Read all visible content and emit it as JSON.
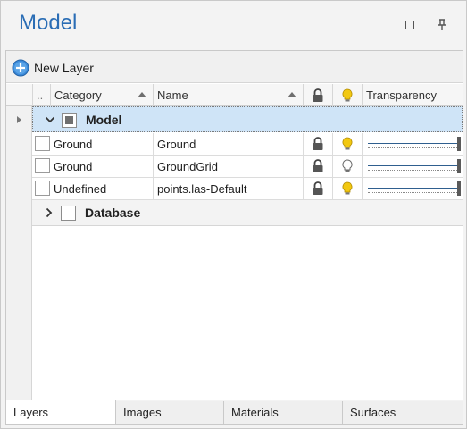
{
  "window": {
    "title": "Model"
  },
  "toolbar": {
    "new_layer_label": "New Layer"
  },
  "columns": {
    "collapse": "..",
    "category": "Category",
    "name": "Name",
    "transparency": "Transparency"
  },
  "groups": [
    {
      "label": "Model",
      "expanded": true,
      "selected": true,
      "checkbox": "indeterminate"
    },
    {
      "label": "Database",
      "expanded": false,
      "selected": false,
      "checkbox": "unchecked"
    }
  ],
  "rows": [
    {
      "category": "Ground",
      "name": "Ground",
      "locked": true,
      "light": "on",
      "transparency": 1.0
    },
    {
      "category": "Ground",
      "name": "GroundGrid",
      "locked": true,
      "light": "off",
      "transparency": 1.0
    },
    {
      "category": "Undefined",
      "name": "points.las-Default",
      "locked": true,
      "light": "on",
      "transparency": 1.0
    }
  ],
  "tabs": [
    {
      "label": "Layers",
      "active": true
    },
    {
      "label": "Images",
      "active": false
    },
    {
      "label": "Materials",
      "active": false
    },
    {
      "label": "Surfaces",
      "active": false
    }
  ],
  "colors": {
    "title": "#2a6db5",
    "selection": "#cfe4f7",
    "bulb_on": "#f2c811",
    "bulb_off": "#ffffff",
    "add_icon": "#3b8ad9"
  },
  "icons": {
    "add": "plus-circle-icon",
    "lock": "lock-icon",
    "light": "lightbulb-icon",
    "maximize": "maximize-icon",
    "pin": "pin-icon"
  }
}
